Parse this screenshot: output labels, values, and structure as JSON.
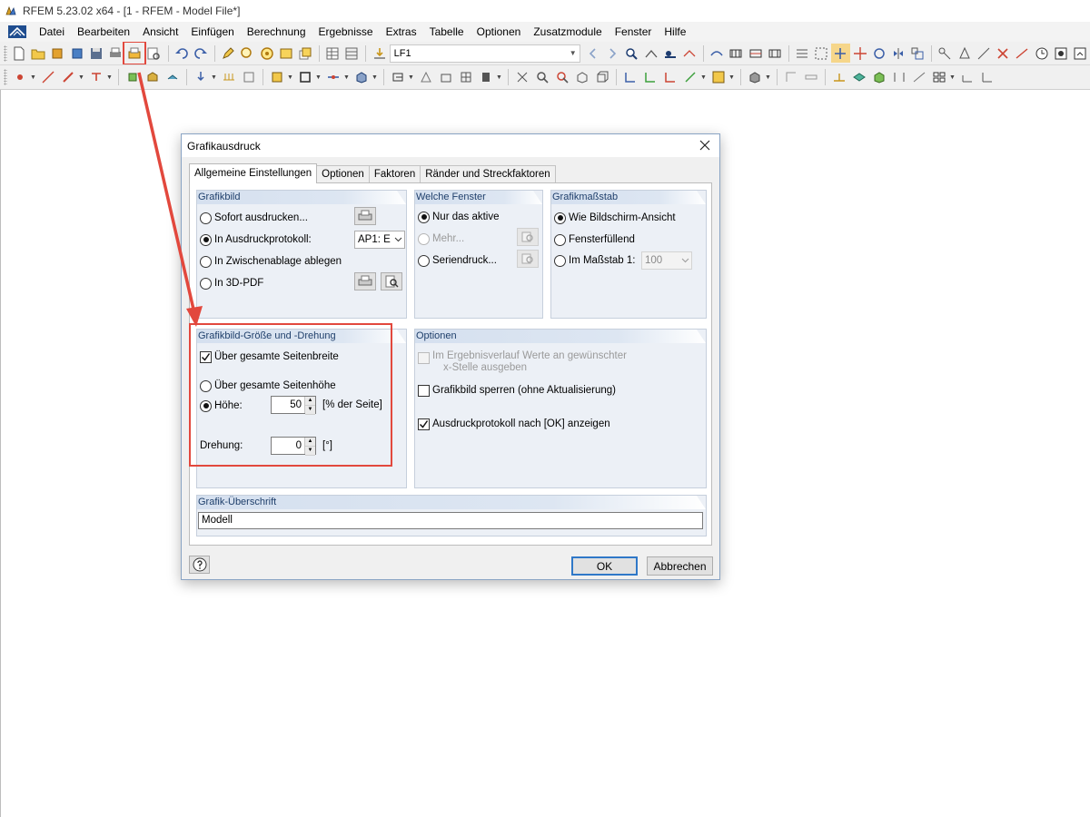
{
  "window": {
    "title": "RFEM 5.23.02 x64 - [1 - RFEM - Model File*]"
  },
  "menubar": {
    "items": [
      "Datei",
      "Bearbeiten",
      "Ansicht",
      "Einfügen",
      "Berechnung",
      "Ergebnisse",
      "Extras",
      "Tabelle",
      "Optionen",
      "Zusatzmodule",
      "Fenster",
      "Hilfe"
    ]
  },
  "toolbar": {
    "load_case_value": "LF1",
    "highlighted_button": "print-graphic-button"
  },
  "dialog": {
    "title": "Grafikausdruck",
    "tabs": [
      "Allgemeine Einstellungen",
      "Optionen",
      "Faktoren",
      "Ränder und Streckfaktoren"
    ],
    "active_tab": "Allgemeine Einstellungen",
    "grafikbild": {
      "header": "Grafikbild",
      "options": [
        "Sofort ausdrucken...",
        "In Ausdruckprotokoll:",
        "In Zwischenablage ablegen",
        "In 3D-PDF"
      ],
      "selected": "In Ausdruckprotokoll:",
      "protocol_value": "AP1: E"
    },
    "welche_fenster": {
      "header": "Welche Fenster",
      "options": [
        "Nur das aktive",
        "Mehr...",
        "Seriendruck..."
      ],
      "selected": "Nur das aktive",
      "disabled": [
        "Mehr..."
      ]
    },
    "massstab": {
      "header": "Grafikmaßstab",
      "options": [
        "Wie Bildschirm-Ansicht",
        "Fensterfüllend",
        "Im Maßstab 1:"
      ],
      "selected": "Wie Bildschirm-Ansicht",
      "scale_value": "100"
    },
    "groesse": {
      "header": "Grafikbild-Größe und -Drehung",
      "width_check": "Über gesamte Seitenbreite",
      "width_checked": true,
      "height_option": "Über gesamte Seitenhöhe",
      "hoehe_label": "Höhe:",
      "hoehe_value": "50",
      "hoehe_unit": "[% der Seite]",
      "hoehe_selected": true,
      "drehung_label": "Drehung:",
      "drehung_value": "0",
      "drehung_unit": "[°]"
    },
    "optionen": {
      "header": "Optionen",
      "opt1_line1": "Im Ergebnisverlauf Werte an gewünschter",
      "opt1_line2": "x-Stelle ausgeben",
      "opt1_checked": false,
      "opt1_disabled": true,
      "opt2": "Grafikbild sperren (ohne Aktualisierung)",
      "opt2_checked": false,
      "opt3": "Ausdruckprotokoll nach [OK] anzeigen",
      "opt3_checked": true
    },
    "ueberschrift": {
      "header": "Grafik-Überschrift",
      "value": "Modell"
    },
    "buttons": {
      "ok": "OK",
      "cancel": "Abbrechen"
    }
  },
  "colors": {
    "annotation_red": "#e2483d",
    "group_header": "#d5e0ef",
    "accent_blue": "#2f78c8"
  }
}
